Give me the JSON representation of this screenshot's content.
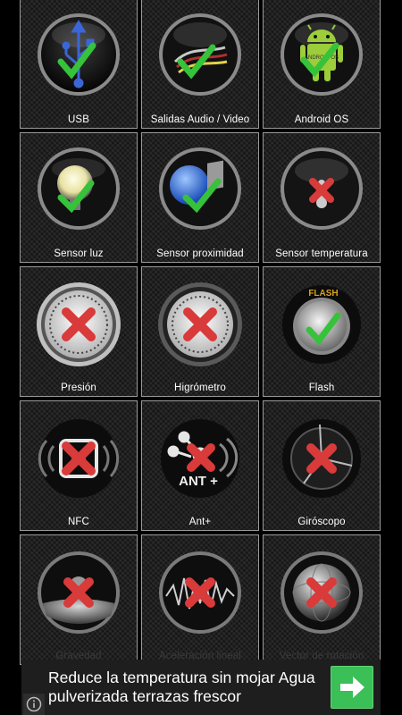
{
  "tiles": [
    {
      "label": "USB",
      "icon": "usb-icon",
      "status": "ok"
    },
    {
      "label": "Salidas Audio / Video",
      "icon": "audio-video-cable-icon",
      "status": "ok"
    },
    {
      "label": "Android OS",
      "icon": "android-robot-icon",
      "status": "ok",
      "badge": "ANDROID OS"
    },
    {
      "label": "Sensor luz",
      "icon": "light-bulb-icon",
      "status": "ok"
    },
    {
      "label": "Sensor proximidad",
      "icon": "proximity-sensor-icon",
      "status": "ok"
    },
    {
      "label": "Sensor temperatura",
      "icon": "thermometer-icon",
      "status": "fail"
    },
    {
      "label": "Presión",
      "icon": "barometer-gauge-icon",
      "status": "fail"
    },
    {
      "label": "Higrómetro",
      "icon": "hygrometer-gauge-icon",
      "status": "fail"
    },
    {
      "label": "Flash",
      "icon": "flash-icon",
      "status": "ok",
      "badge": "FLASH"
    },
    {
      "label": "NFC",
      "icon": "nfc-icon",
      "status": "fail",
      "badge": "N"
    },
    {
      "label": "Ant+",
      "icon": "ant-plus-icon",
      "status": "fail",
      "badge": "ANT +"
    },
    {
      "label": "Giróscopo",
      "icon": "gyroscope-icon",
      "status": "fail"
    },
    {
      "label": "Gravedad",
      "icon": "gravity-earth-icon",
      "status": "fail"
    },
    {
      "label": "Aceleración lineal",
      "icon": "linear-acceleration-wave-icon",
      "status": "fail"
    },
    {
      "label": "Vector de rotación",
      "icon": "rotation-globe-icon",
      "status": "fail"
    }
  ],
  "ad": {
    "text": "Reduce la temperatura sin mojar Agua pulverizada terrazas frescor",
    "button_icon": "arrow-right-icon",
    "info_icon": "info-icon"
  },
  "colors": {
    "ok": "#36c23a",
    "fail": "#d93a3a",
    "ad_button": "#3bbf57"
  }
}
